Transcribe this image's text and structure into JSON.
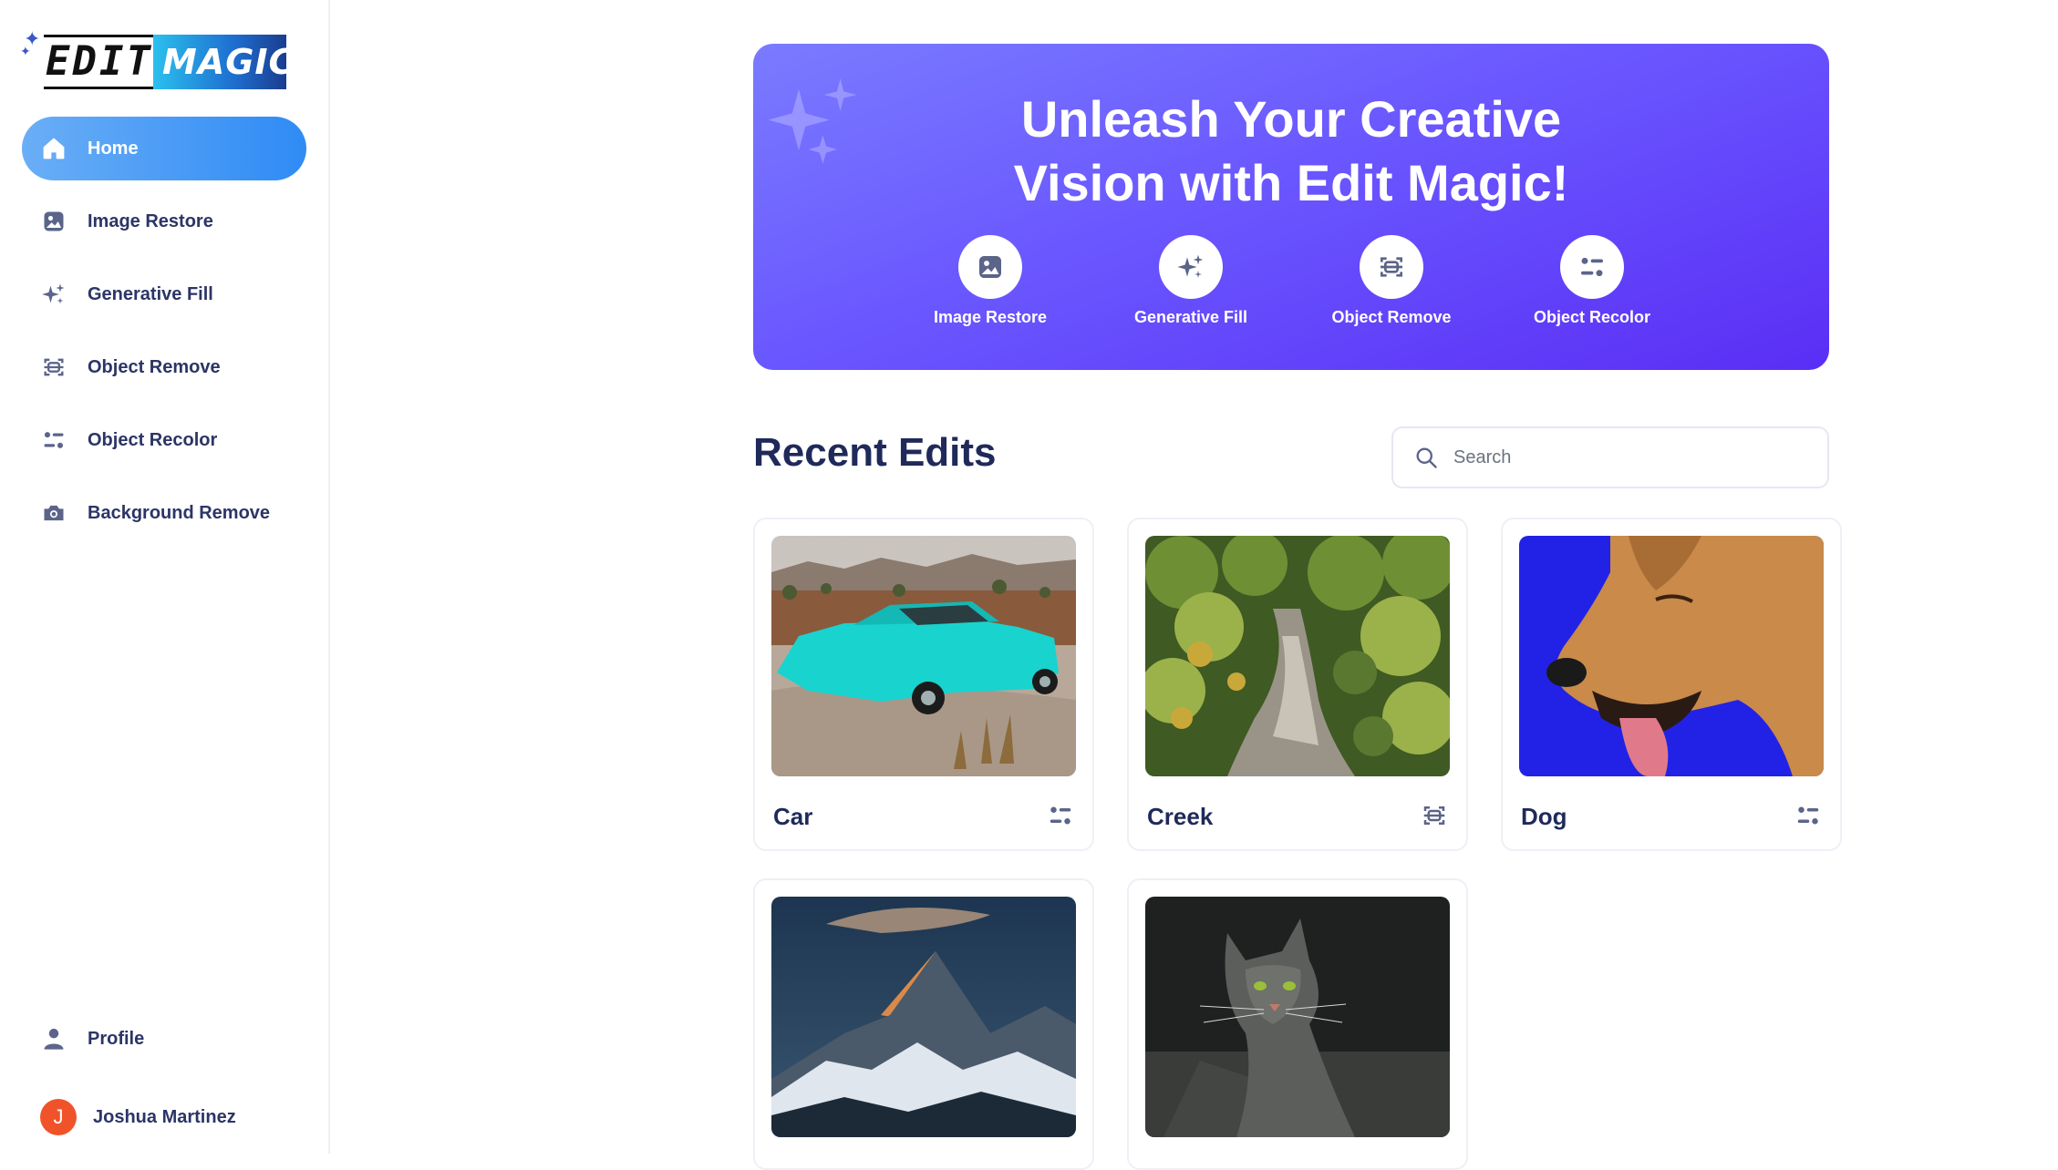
{
  "app": {
    "logo_edit": "EDIT",
    "logo_magic": "MAGIC"
  },
  "sidebar": {
    "items": [
      {
        "label": "Home",
        "icon": "home-icon",
        "active": true
      },
      {
        "label": "Image Restore",
        "icon": "image-restore-icon",
        "active": false
      },
      {
        "label": "Generative Fill",
        "icon": "sparkles-icon",
        "active": false
      },
      {
        "label": "Object Remove",
        "icon": "object-remove-icon",
        "active": false
      },
      {
        "label": "Object Recolor",
        "icon": "object-recolor-icon",
        "active": false
      },
      {
        "label": "Background Remove",
        "icon": "camera-icon",
        "active": false
      }
    ],
    "profile_label": "Profile",
    "user_initial": "J",
    "user_name": "Joshua Martinez"
  },
  "hero": {
    "title_line1": "Unleash Your Creative",
    "title_line2": "Vision with Edit Magic!",
    "actions": [
      {
        "label": "Image Restore",
        "icon": "image-restore-icon"
      },
      {
        "label": "Generative Fill",
        "icon": "sparkles-icon"
      },
      {
        "label": "Object Remove",
        "icon": "object-remove-icon"
      },
      {
        "label": "Object Recolor",
        "icon": "object-recolor-icon"
      }
    ]
  },
  "recent": {
    "title": "Recent Edits",
    "search_placeholder": "Search",
    "items": [
      {
        "name": "Car",
        "tool_icon": "object-recolor-icon"
      },
      {
        "name": "Creek",
        "tool_icon": "object-remove-icon"
      },
      {
        "name": "Dog",
        "tool_icon": "object-recolor-icon"
      },
      {
        "name": "",
        "tool_icon": ""
      },
      {
        "name": "",
        "tool_icon": ""
      }
    ]
  },
  "colors": {
    "accent": "#2f8bf5",
    "hero_start": "#7a7bff",
    "hero_end": "#5a2ef5",
    "text_dark": "#1f2a5a",
    "icon_gray": "#5b6489",
    "avatar": "#f0532a"
  }
}
